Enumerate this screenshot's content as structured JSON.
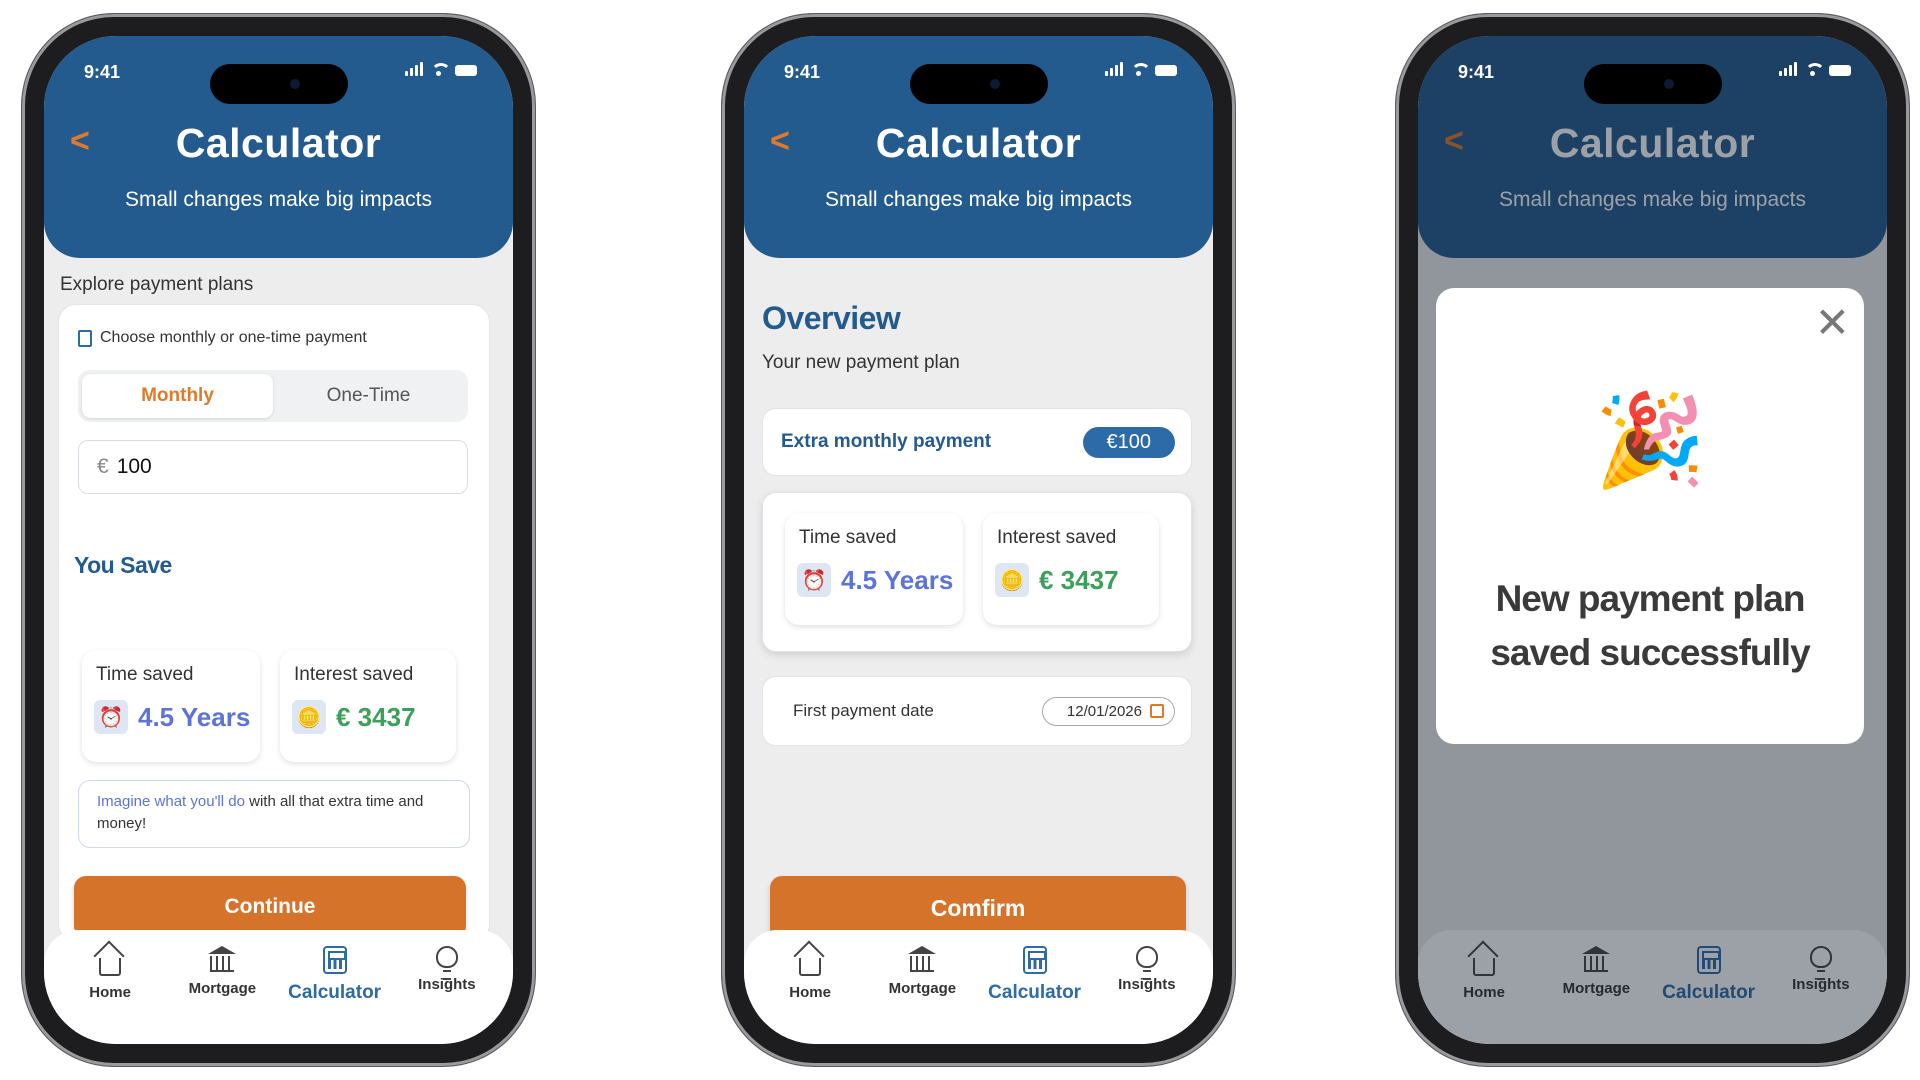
{
  "status": {
    "time": "9:41"
  },
  "header": {
    "title": "Calculator",
    "subtitle": "Small changes make big impacts"
  },
  "nav": {
    "items": [
      {
        "label": "Home",
        "icon": "home-icon"
      },
      {
        "label": "Mortgage",
        "icon": "bank-icon"
      },
      {
        "label": "Calculator",
        "icon": "calculator-icon",
        "active": true
      },
      {
        "label": "Insights",
        "icon": "lightbulb-icon"
      }
    ]
  },
  "screen1": {
    "explore": "Explore payment plans",
    "choose": "Choose monthly or one-time payment",
    "tabs": [
      "Monthly",
      "One-Time"
    ],
    "currency": "€",
    "amount": "100",
    "you_save": "You Save",
    "time_saved_label": "Time saved",
    "time_saved_value": "4.5 Years",
    "interest_saved_label": "Interest saved",
    "interest_saved_value": "€ 3437",
    "imagine_highlight": "Imagine what you'll do",
    "imagine_rest": "with all that extra time and money!",
    "continue": "Continue"
  },
  "screen2": {
    "title": "Overview",
    "subtitle": "Your new payment plan",
    "extra_label": "Extra monthly payment",
    "extra_value": "€100",
    "time_saved_label": "Time saved",
    "time_saved_value": "4.5 Years",
    "interest_saved_label": "Interest saved",
    "interest_saved_value": "€ 3437",
    "first_payment_label": "First payment date",
    "first_payment_date": "12/01/2026",
    "confirm": "Comfirm"
  },
  "screen3": {
    "message": "New payment plan saved successfully",
    "close": "✕",
    "emoji": "🎉"
  },
  "colors": {
    "primary": "#235b8e",
    "accent": "#d5732b",
    "time": "#5d73d8",
    "money": "#3aa05a"
  }
}
